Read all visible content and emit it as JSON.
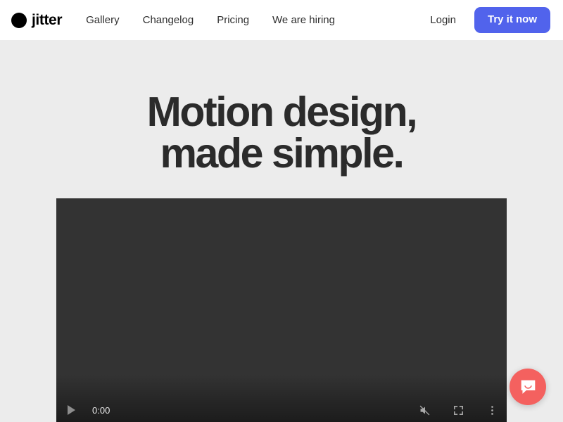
{
  "header": {
    "brand": {
      "name": "jitter",
      "mark_icon": "circle-logo-icon"
    },
    "nav": [
      {
        "label": "Gallery"
      },
      {
        "label": "Changelog"
      },
      {
        "label": "Pricing"
      },
      {
        "label": "We are hiring"
      }
    ],
    "login_label": "Login",
    "cta_label": "Try it now",
    "cta_color": "#5163ec",
    "background": "#ffffff"
  },
  "hero": {
    "title": "Motion design,\nmade simple.",
    "background": "#ececec",
    "title_color": "#2b2b2b"
  },
  "video": {
    "background": "#333333",
    "current_time": "0:00",
    "play_icon": "play-icon",
    "mute_icon": "volume-muted-icon",
    "fullscreen_icon": "fullscreen-icon",
    "more_icon": "kebab-menu-icon"
  },
  "chat": {
    "icon": "chat-bubble-smile-icon",
    "color": "#f4615f"
  }
}
